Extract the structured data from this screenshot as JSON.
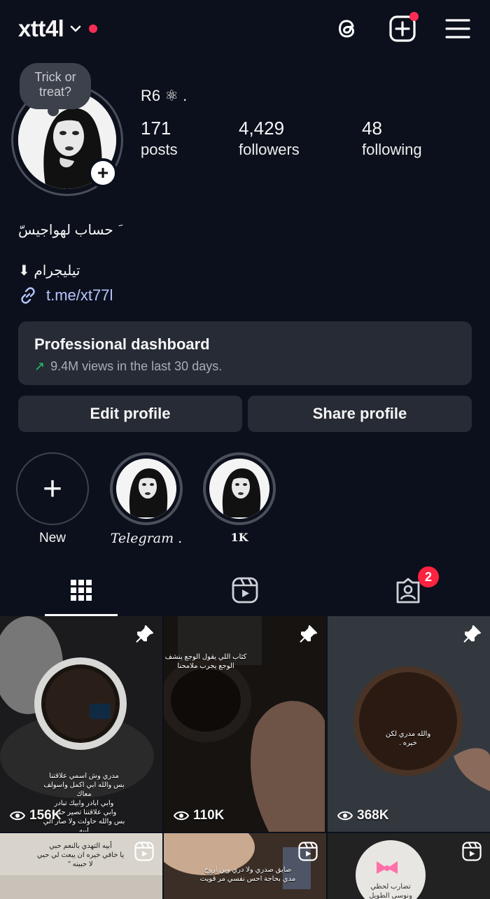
{
  "header": {
    "username": "xtt4l"
  },
  "profile": {
    "note": "Trick or treat?",
    "display_name": "R6 ⚛ .",
    "stats": [
      {
        "value": "171",
        "label": "posts"
      },
      {
        "value": "4,429",
        "label": "followers"
      },
      {
        "value": "48",
        "label": "following"
      }
    ],
    "bio_line1": "َ حساب لهواجيسّ",
    "bio_line2": "تيليجرام ⬇",
    "link": "t.me/xt77l"
  },
  "dashboard": {
    "title": "Professional dashboard",
    "subtitle": "9.4M views in the last 30 days."
  },
  "buttons": {
    "edit": "Edit profile",
    "share": "Share profile"
  },
  "highlights": [
    {
      "label": "New"
    },
    {
      "label": "Telegram ."
    },
    {
      "label": "1K"
    }
  ],
  "tabs": {
    "tagged_badge": "2"
  },
  "posts": [
    {
      "views": "156K",
      "caption": "مدري وش اسمي علاقتنا\nبس والله ابي اكمل واسولف معاك\nوابي ابادر وابيك تبادر\nوابي علاقتنا تصير حلوه\nبس والله حاولت ولا صار الي ابيه"
    },
    {
      "views": "110K",
      "caption": "كثاب اللي يقول الوجع ينشف\nالوجع يجرب ملامحنا"
    },
    {
      "views": "368K",
      "caption": "والله مدري لكن\nخيره ."
    },
    {
      "caption": "أبيه التهدي بالنعم حبي\nيا خافي خيره ان يبعث لي حبي\nلا حبينه \""
    },
    {
      "caption": "صايق صدري ولا دري وين اروح\nمدي بحاجة احس نفسي مر قويت"
    },
    {
      "caption": "تضارب لحظي\nونوسي الطويل"
    }
  ]
}
